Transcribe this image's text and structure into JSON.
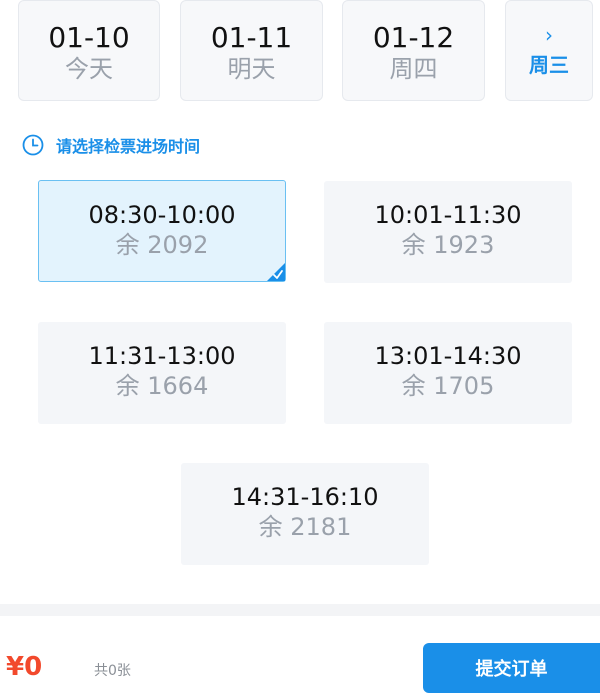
{
  "dates": [
    {
      "date": "01-10",
      "label": "今天"
    },
    {
      "date": "01-11",
      "label": "明天"
    },
    {
      "date": "01-12",
      "label": "周四"
    }
  ],
  "more": {
    "arrow": "›",
    "label": "周三"
  },
  "hint": {
    "text": "请选择检票进场时间",
    "icon": "clock-icon"
  },
  "slots": [
    {
      "time": "08:30-10:00",
      "remain": "余 2092",
      "selected": true
    },
    {
      "time": "10:01-11:30",
      "remain": "余 1923",
      "selected": false
    },
    {
      "time": "11:31-13:00",
      "remain": "余 1664",
      "selected": false
    },
    {
      "time": "13:01-14:30",
      "remain": "余 1705",
      "selected": false
    },
    {
      "time": "14:31-16:10",
      "remain": "余 2181",
      "selected": false
    }
  ],
  "footer": {
    "price": "¥0",
    "count": "共0张",
    "submit_label": "提交订单"
  },
  "colors": {
    "accent": "#1a8fe8",
    "price": "#f2492c",
    "selected_bg": "#e3f3fd"
  }
}
